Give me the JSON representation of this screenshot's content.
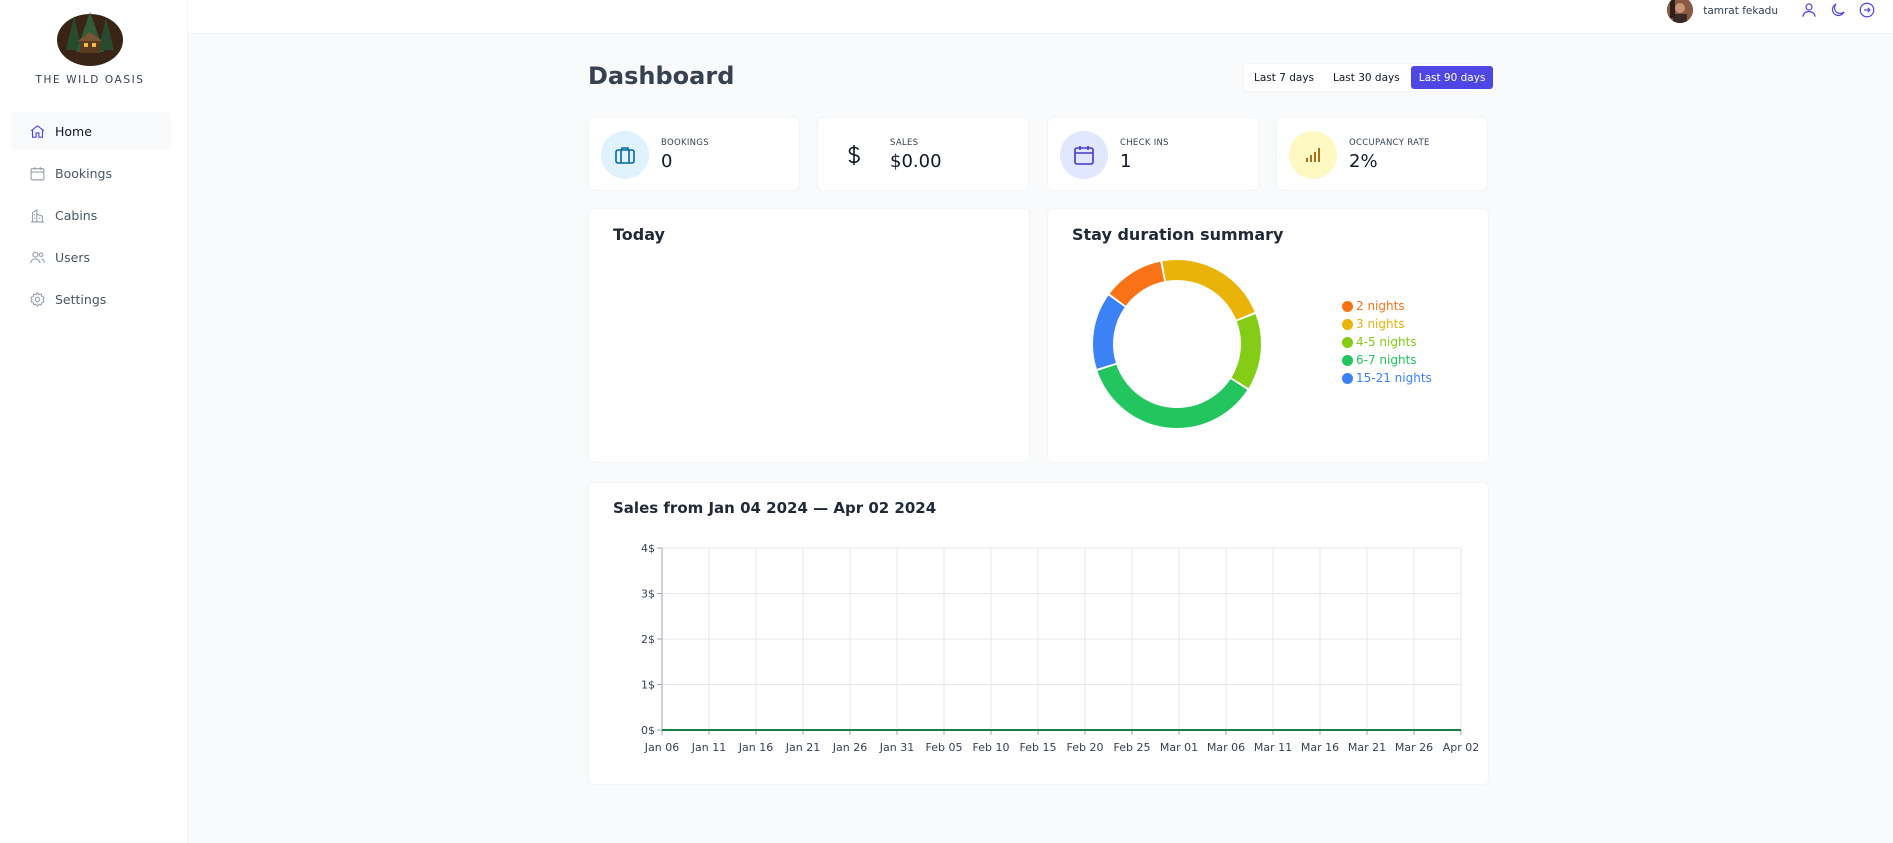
{
  "brand": {
    "name": "THE WILD OASIS"
  },
  "sidebar": {
    "items": [
      {
        "label": "Home",
        "icon": "home-icon",
        "active": true
      },
      {
        "label": "Bookings",
        "icon": "calendar-icon",
        "active": false
      },
      {
        "label": "Cabins",
        "icon": "cabins-icon",
        "active": false
      },
      {
        "label": "Users",
        "icon": "users-icon",
        "active": false
      },
      {
        "label": "Settings",
        "icon": "settings-icon",
        "active": false
      }
    ]
  },
  "header": {
    "user_name": "tamrat fekadu",
    "icons": [
      "user-icon",
      "moon-icon",
      "logout-icon"
    ]
  },
  "dashboard": {
    "title": "Dashboard",
    "filter": {
      "options": [
        "Last 7 days",
        "Last 30 days",
        "Last 90 days"
      ],
      "selected": "Last 90 days"
    },
    "stats": [
      {
        "label": "BOOKINGS",
        "value": "0",
        "icon": "briefcase-icon",
        "color": "#e0f2fe",
        "icon_color": "#0369a1"
      },
      {
        "label": "SALES",
        "value": "$0.00",
        "icon": "dollar-icon",
        "color": "#ffffff",
        "icon_color": "#111827"
      },
      {
        "label": "CHECK INS",
        "value": "1",
        "icon": "calendar-icon",
        "color": "#e0e7ff",
        "icon_color": "#4338ca"
      },
      {
        "label": "OCCUPANCY RATE",
        "value": "2%",
        "icon": "chart-bar-icon",
        "color": "#fef9c3",
        "icon_color": "#a16207"
      }
    ],
    "today_title": "Today",
    "duration_title": "Stay duration summary",
    "sales_title": "Sales from Jan 04 2024 — Apr 02 2024"
  },
  "chart_data": [
    {
      "type": "pie",
      "title": "Stay duration summary",
      "categories": [
        "2 nights",
        "3 nights",
        "4-5 nights",
        "6-7 nights",
        "15-21 nights"
      ],
      "values": [
        12,
        22,
        15,
        36,
        15
      ],
      "colors": [
        "#f97316",
        "#eab308",
        "#84cc16",
        "#22c55e",
        "#3b82f6"
      ]
    },
    {
      "type": "line",
      "title": "Sales from Jan 04 2024 — Apr 02 2024",
      "x_ticks": [
        "Jan 06",
        "Jan 11",
        "Jan 16",
        "Jan 21",
        "Jan 26",
        "Jan 31",
        "Feb 05",
        "Feb 10",
        "Feb 15",
        "Feb 20",
        "Feb 25",
        "Mar 01",
        "Mar 06",
        "Mar 11",
        "Mar 16",
        "Mar 21",
        "Mar 26",
        "Apr 02"
      ],
      "y_ticks": [
        "0$",
        "1$",
        "2$",
        "3$",
        "4$"
      ],
      "ylim": [
        0,
        4
      ],
      "series": [
        {
          "values": [
            0,
            0,
            0,
            0,
            0,
            0,
            0,
            0,
            0,
            0,
            0,
            0,
            0,
            0,
            0,
            0,
            0,
            0
          ]
        }
      ],
      "line_color": "#15803d",
      "grid": true
    }
  ]
}
